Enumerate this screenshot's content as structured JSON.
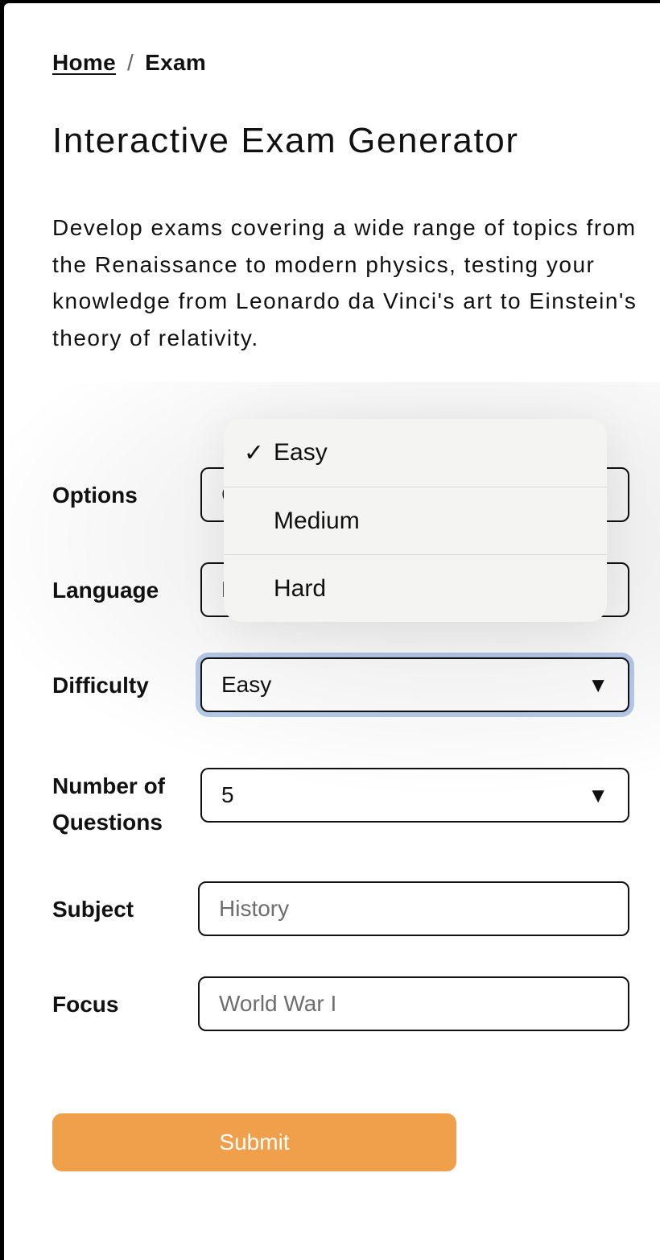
{
  "breadcrumb": {
    "home": "Home",
    "separator": "/",
    "current": "Exam"
  },
  "title": "Interactive Exam Generator",
  "description": "Develop exams covering a wide range of topics from the Renaissance to modern physics, testing your knowledge from Leonardo da Vinci's art to Einstein's theory of relativity.",
  "form": {
    "options": {
      "label": "Options",
      "value": "",
      "icon": "chevron-down-icon"
    },
    "language": {
      "label": "Language",
      "value": "",
      "icon": "chevron-down-icon"
    },
    "difficulty": {
      "label": "Difficulty",
      "value": "Easy",
      "icon": "chevron-down-icon",
      "focused": true
    },
    "num_questions": {
      "label": "Number of Questions",
      "label_line1": "Number of",
      "label_line2": "Questions",
      "value": "5",
      "icon": "chevron-down-icon"
    },
    "subject": {
      "label": "Subject",
      "placeholder": "History",
      "value": ""
    },
    "focus": {
      "label": "Focus",
      "placeholder": "World War I",
      "value": ""
    },
    "submit_label": "Submit",
    "arrow_glyph": "▼"
  },
  "difficulty_dropdown": {
    "open": true,
    "options": [
      {
        "label": "Easy",
        "selected": true,
        "check": "✓"
      },
      {
        "label": "Medium",
        "selected": false,
        "check": ""
      },
      {
        "label": "Hard",
        "selected": false,
        "check": ""
      }
    ]
  },
  "colors": {
    "accent": "#f0a04b",
    "focus_ring": "#b7cbea",
    "text": "#111111",
    "placeholder": "#6e6e6e",
    "dropdown_bg": "#f4f4f3"
  }
}
